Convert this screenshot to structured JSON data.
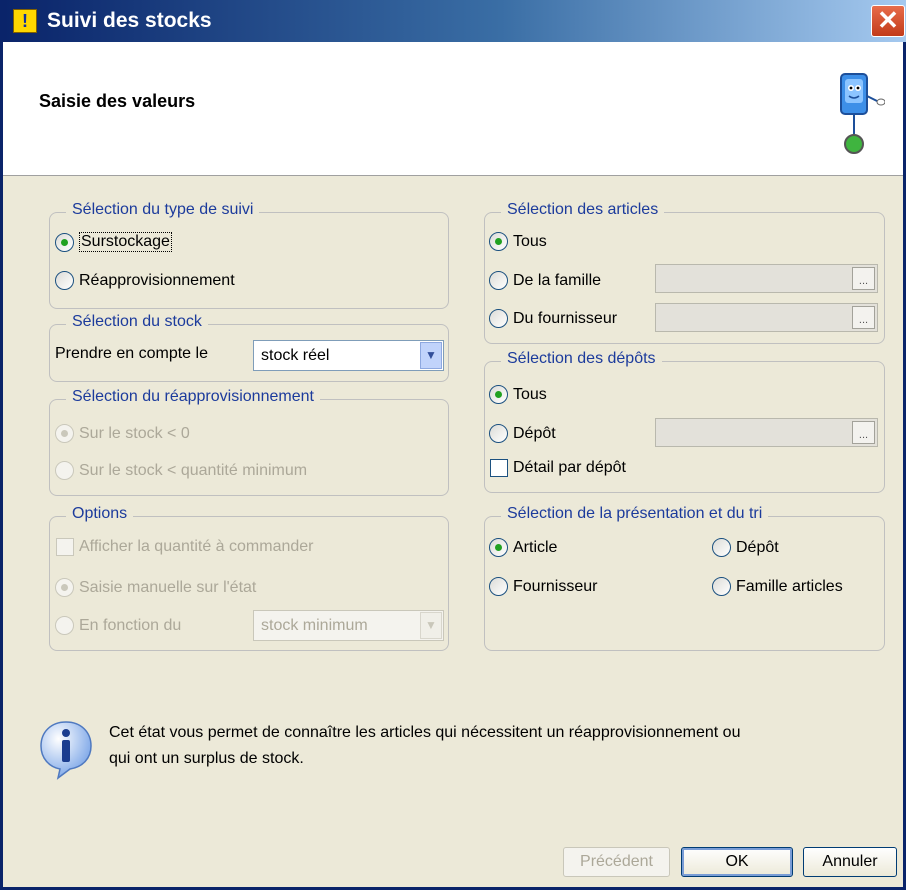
{
  "window": {
    "title": "Suivi des stocks"
  },
  "header": {
    "title": "Saisie des valeurs"
  },
  "type_suivi": {
    "title": "Sélection du type de suivi",
    "surstockage": "Surstockage",
    "reappro": "Réapprovisionnement",
    "selected": "Surstockage"
  },
  "stock": {
    "title": "Sélection du stock",
    "label": "Prendre en compte le",
    "value": "stock réel"
  },
  "reappro_selection": {
    "title": "Sélection du réapprovisionnement",
    "option1": "Sur le stock < 0",
    "option2": "Sur le stock < quantité minimum",
    "selected": "Sur le stock < 0"
  },
  "options": {
    "title": "Options",
    "afficher": "Afficher la quantité à commander",
    "saisie": "Saisie manuelle sur l'état",
    "fonction": "En fonction du",
    "fonction_value": "stock minimum",
    "selected": "Saisie manuelle sur l'état"
  },
  "articles": {
    "title": "Sélection des articles",
    "tous": "Tous",
    "famille": "De la famille",
    "fournisseur": "Du fournisseur",
    "browse_label": "...",
    "selected": "Tous"
  },
  "depots": {
    "title": "Sélection des dépôts",
    "tous": "Tous",
    "depot": "Dépôt",
    "detail": "Détail par dépôt",
    "selected": "Tous"
  },
  "presentation": {
    "title": "Sélection de la présentation et du tri",
    "article": "Article",
    "depot": "Dépôt",
    "fournisseur": "Fournisseur",
    "famille": "Famille articles",
    "selected": "Article"
  },
  "info": {
    "text": "Cet état vous permet de connaître les articles qui nécessitent un réapprovisionnement ou qui ont un surplus de stock."
  },
  "buttons": {
    "previous": "Précédent",
    "ok": "OK",
    "cancel": "Annuler"
  },
  "colors": {
    "group_title": "#1c3b9c",
    "selected_radio": "#21a121"
  }
}
